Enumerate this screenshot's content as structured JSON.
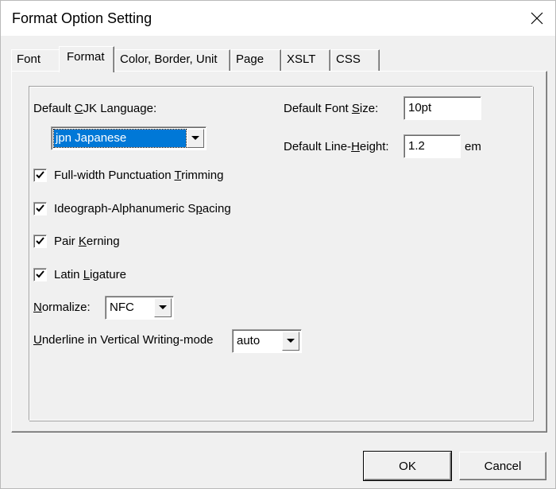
{
  "window": {
    "title": "Format Option Setting"
  },
  "tabs": [
    {
      "label": "Font",
      "active": false
    },
    {
      "label": "Format",
      "active": true
    },
    {
      "label": "Color, Border, Unit",
      "active": false
    },
    {
      "label": "Page",
      "active": false
    },
    {
      "label": "XSLT",
      "active": false
    },
    {
      "label": "CSS",
      "active": false
    }
  ],
  "format": {
    "cjk_language": {
      "label_pre": "Default ",
      "label_key": "C",
      "label_post": "JK Language:",
      "value": "jpn Japanese"
    },
    "font_size": {
      "label_pre": "Default Font ",
      "label_key": "S",
      "label_post": "ize:",
      "value": "10pt"
    },
    "line_height": {
      "label_pre": "Default Line-",
      "label_key": "H",
      "label_post": "eight:",
      "value": "1.2",
      "unit": "em"
    },
    "checks": [
      {
        "pre": "Full-width Punctuation ",
        "key": "T",
        "post": "rimming",
        "checked": true
      },
      {
        "pre": "Ideograph-Alphanumeric S",
        "key": "p",
        "post": "acing",
        "checked": true
      },
      {
        "pre": "Pair ",
        "key": "K",
        "post": "erning",
        "checked": true
      },
      {
        "pre": "Latin ",
        "key": "L",
        "post": "igature",
        "checked": true
      }
    ],
    "normalize": {
      "label_key": "N",
      "label_post": "ormalize:",
      "value": "NFC"
    },
    "underline": {
      "label_key": "U",
      "label_post": "nderline in Vertical Writing-mode",
      "value": "auto"
    }
  },
  "buttons": {
    "ok": "OK",
    "cancel": "Cancel"
  },
  "icons": {
    "close": "close-icon",
    "dropdown": "chevron-down-icon",
    "check": "checkmark-icon"
  },
  "colors": {
    "selection": "#0078d7",
    "face": "#f0f0f0"
  }
}
